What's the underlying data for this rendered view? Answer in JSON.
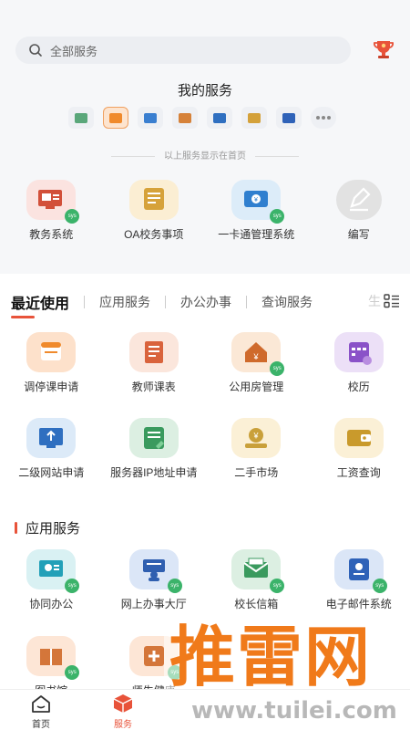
{
  "search": {
    "placeholder": "全部服务"
  },
  "my_services": {
    "title": "我的服务",
    "icons": [
      {
        "icon": "green-doc-icon",
        "color": "#5aa77a"
      },
      {
        "icon": "orange-card-icon",
        "color": "#f08a2c"
      },
      {
        "icon": "blue-screen-icon",
        "color": "#3a7fd0"
      },
      {
        "icon": "house-icon",
        "color": "#d6823a"
      },
      {
        "icon": "blue-browser-icon",
        "color": "#2f6fc0"
      },
      {
        "icon": "money-bag-icon",
        "color": "#d4a13a"
      },
      {
        "icon": "blue-folder-icon",
        "color": "#2f62b8"
      },
      {
        "icon": "more-icon",
        "color": "#888888"
      }
    ],
    "note": "以上服务显示在首页"
  },
  "home_services": [
    {
      "label": "教务系统",
      "icon": "teaching-system-icon",
      "bg": "#fbe3e0",
      "fg": "#d2503a",
      "badge": "sys"
    },
    {
      "label": "OA校务事项",
      "icon": "oa-affairs-icon",
      "bg": "#fbeed3",
      "fg": "#d6a23a",
      "badge": ""
    },
    {
      "label": "一卡通管理系统",
      "icon": "card-management-icon",
      "bg": "#dcecf9",
      "fg": "#2f7fcf",
      "badge": "sys"
    },
    {
      "label": "编写",
      "icon": "edit-icon",
      "bg": "#e2e2e2",
      "fg": "#ffffff",
      "badge": ""
    }
  ],
  "tabs": [
    "最近使用",
    "应用服务",
    "办公办事",
    "查询服务",
    "生"
  ],
  "recent": [
    {
      "label": "调停课申请",
      "icon": "class-adjust-icon",
      "bg": "#fde1cb",
      "fg": "#f08a2c",
      "badge": ""
    },
    {
      "label": "教师课表",
      "icon": "teacher-timetable-icon",
      "bg": "#fbe6dc",
      "fg": "#d9633c",
      "badge": ""
    },
    {
      "label": "公用房管理",
      "icon": "public-housing-icon",
      "bg": "#fbe8d6",
      "fg": "#cf6a2c",
      "badge": "sys"
    },
    {
      "label": "校历",
      "icon": "school-calendar-icon",
      "bg": "#ece0f7",
      "fg": "#8a52c8",
      "badge": ""
    },
    {
      "label": "二级网站申请",
      "icon": "sub-site-icon",
      "bg": "#dceaf8",
      "fg": "#2f6fc0",
      "badge": ""
    },
    {
      "label": "服务器IP地址申请",
      "icon": "server-ip-icon",
      "bg": "#dcefe2",
      "fg": "#3a9a5e",
      "badge": ""
    },
    {
      "label": "二手市场",
      "icon": "second-hand-icon",
      "bg": "#fbf0d6",
      "fg": "#c9a03a",
      "badge": ""
    },
    {
      "label": "工资查询",
      "icon": "salary-query-icon",
      "bg": "#fbf0d6",
      "fg": "#c99a2c",
      "badge": ""
    }
  ],
  "app_section": {
    "title": "应用服务"
  },
  "app_services": [
    {
      "label": "协同办公",
      "icon": "collab-office-icon",
      "bg": "#d9f1f3",
      "fg": "#22a0b8",
      "badge": "sys"
    },
    {
      "label": "网上办事大厅",
      "icon": "online-hall-icon",
      "bg": "#dbe6f7",
      "fg": "#2f5fb0",
      "badge": "sys"
    },
    {
      "label": "校长信箱",
      "icon": "president-mailbox-icon",
      "bg": "#dcefe2",
      "fg": "#3a9a5e",
      "badge": "sys"
    },
    {
      "label": "电子邮件系统",
      "icon": "email-system-icon",
      "bg": "#dbe6f7",
      "fg": "#2f62b8",
      "badge": "sys"
    },
    {
      "label": "图书馆",
      "icon": "library-icon",
      "bg": "#fde6d6",
      "fg": "#d4763a",
      "badge": "sys"
    },
    {
      "label": "师生健康",
      "icon": "health-icon",
      "bg": "#fde6d6",
      "fg": "#d4763a",
      "badge": "sys"
    }
  ],
  "bottom_nav": [
    {
      "label": "首页",
      "icon": "home-icon",
      "active": false
    },
    {
      "label": "服务",
      "icon": "service-cube-icon",
      "active": true
    }
  ],
  "watermark": {
    "brand": "推雷网",
    "url": "www.tuilei.com"
  },
  "colors": {
    "accent": "#e8533a",
    "sys_badge": "#3bb36a"
  }
}
